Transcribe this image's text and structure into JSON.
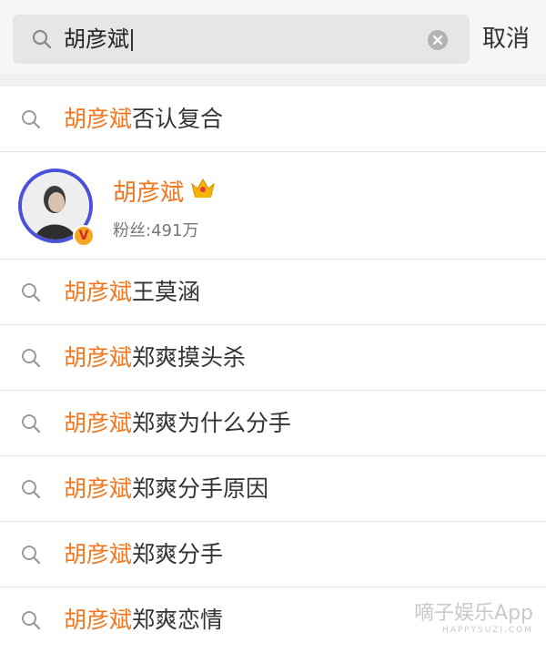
{
  "search": {
    "query": "胡彦斌",
    "cancel_label": "取消"
  },
  "user": {
    "name": "胡彦斌",
    "fans": "粉丝:491万",
    "verified_badge": "V"
  },
  "suggestions": [
    {
      "highlight": "胡彦斌",
      "rest": "否认复合"
    },
    {
      "highlight": "胡彦斌",
      "rest": "王莫涵"
    },
    {
      "highlight": "胡彦斌",
      "rest": "郑爽摸头杀"
    },
    {
      "highlight": "胡彦斌",
      "rest": "郑爽为什么分手"
    },
    {
      "highlight": "胡彦斌",
      "rest": "郑爽分手原因"
    },
    {
      "highlight": "胡彦斌",
      "rest": "郑爽分手"
    },
    {
      "highlight": "胡彦斌",
      "rest": "郑爽恋情"
    }
  ],
  "watermark": {
    "main": "嘀子娱乐App",
    "sub": "HAPPYSUZI.COM"
  },
  "colors": {
    "highlight": "#f0771f",
    "avatar_ring": "#4a52d9"
  }
}
